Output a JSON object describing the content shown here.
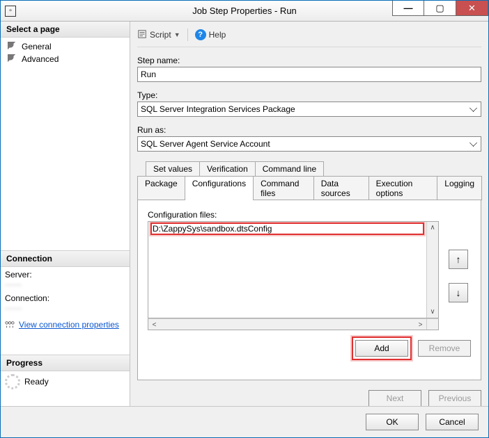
{
  "window": {
    "title": "Job Step Properties - Run"
  },
  "sidebar": {
    "select_page": "Select a page",
    "pages": [
      {
        "label": "General"
      },
      {
        "label": "Advanced"
      }
    ],
    "connection_hdr": "Connection",
    "server_label": "Server:",
    "server_value": "——",
    "connection_label": "Connection:",
    "connection_value": "——",
    "view_props": "View connection properties",
    "progress_hdr": "Progress",
    "progress_status": "Ready"
  },
  "toolbar": {
    "script": "Script",
    "help": "Help"
  },
  "form": {
    "step_name_label": "Step name:",
    "step_name_value": "Run",
    "type_label": "Type:",
    "type_value": "SQL Server Integration Services Package",
    "run_as_label": "Run as:",
    "run_as_value": "SQL Server Agent Service Account"
  },
  "tabs": {
    "row1": [
      "Set values",
      "Verification",
      "Command line"
    ],
    "row2": [
      "Package",
      "Configurations",
      "Command files",
      "Data sources",
      "Execution options",
      "Logging"
    ],
    "active": "Configurations"
  },
  "config": {
    "label": "Configuration files:",
    "files": [
      "D:\\ZappySys\\sandbox.dtsConfig"
    ],
    "add": "Add",
    "remove": "Remove"
  },
  "nav": {
    "next": "Next",
    "previous": "Previous"
  },
  "footer": {
    "ok": "OK",
    "cancel": "Cancel"
  }
}
